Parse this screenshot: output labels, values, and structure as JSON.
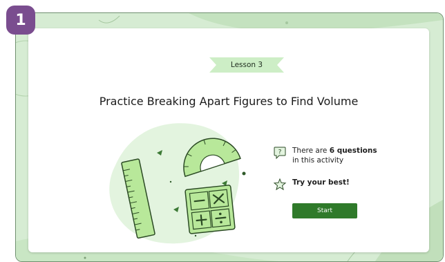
{
  "step_badge": "1",
  "lesson_label": "Lesson 3",
  "title": "Practice Breaking Apart Figures to Find Volume",
  "info": {
    "questions_prefix": "There are ",
    "questions_count": "6 questions",
    "questions_suffix": "in this activity",
    "question_icon_glyph": "?",
    "encouragement": "Try your best!"
  },
  "start_button": "Start",
  "icons": [
    "question-bubble-icon",
    "star-icon",
    "ruler-icon",
    "protractor-icon",
    "calculator-icon"
  ],
  "colors": {
    "accent_green": "#2f7a2a",
    "light_green": "#d6ecd3",
    "tag_green": "#cdeec6",
    "badge_purple": "#7a4d8f"
  }
}
